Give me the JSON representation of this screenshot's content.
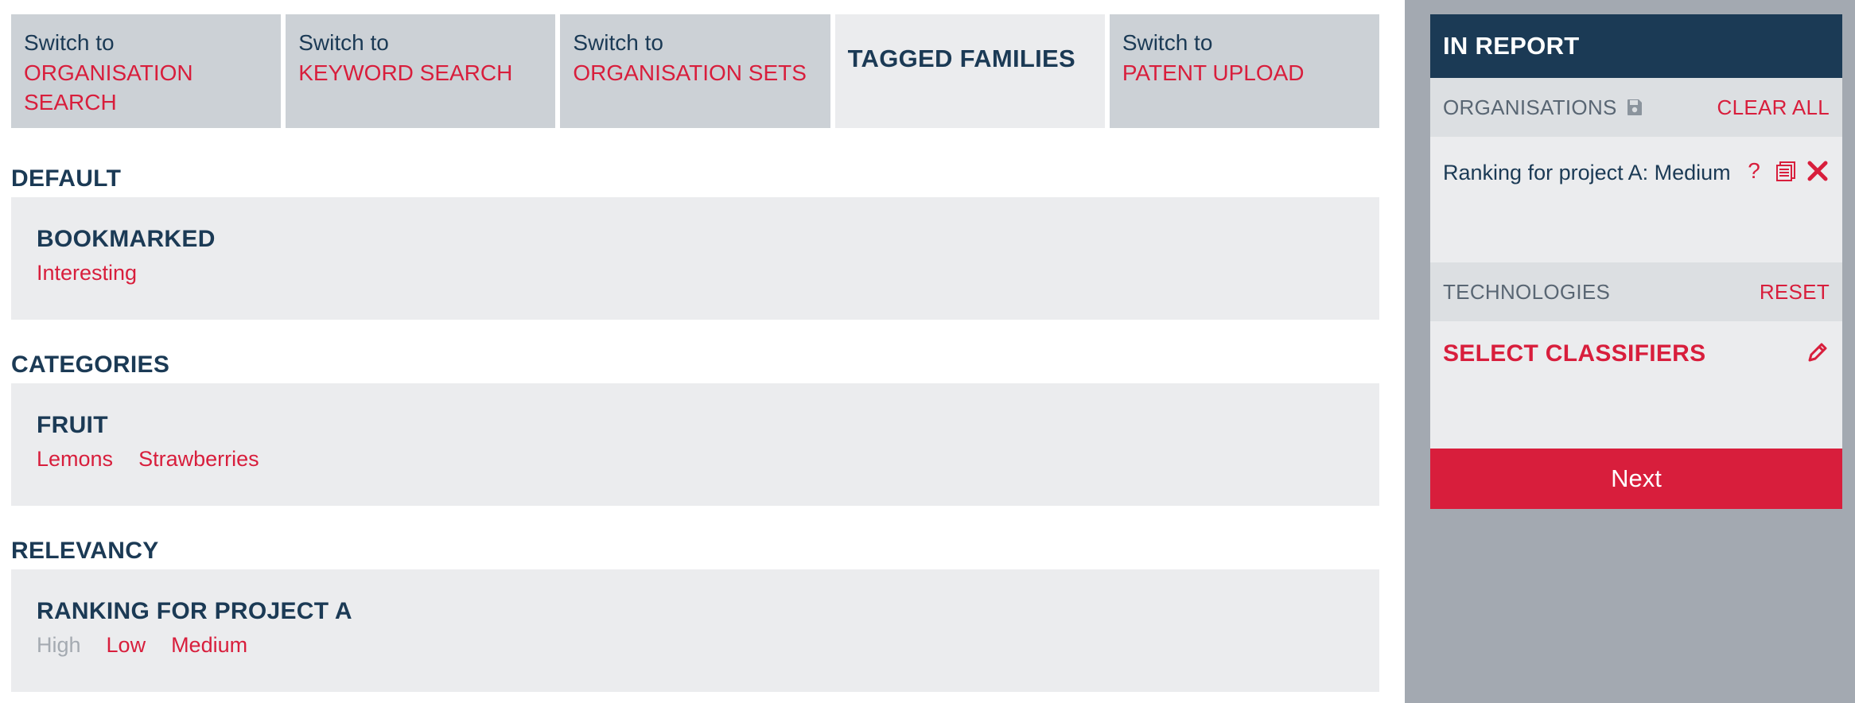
{
  "tabs": [
    {
      "line1": "Switch to",
      "line2": "ORGANISATION SEARCH"
    },
    {
      "line1": "Switch to",
      "line2": "KEYWORD SEARCH"
    },
    {
      "line1": "Switch to",
      "line2": "ORGANISATION SETS"
    },
    {
      "title": "TAGGED FAMILIES"
    },
    {
      "line1": "Switch to",
      "line2": "PATENT UPLOAD"
    }
  ],
  "sections": {
    "default": {
      "title": "DEFAULT",
      "panel_heading": "BOOKMARKED",
      "tags": [
        "Interesting"
      ]
    },
    "categories": {
      "title": "CATEGORIES",
      "panel_heading": "FRUIT",
      "tags": [
        "Lemons",
        "Strawberries"
      ]
    },
    "relevancy": {
      "title": "RELEVANCY",
      "panel_heading": "RANKING FOR PROJECT A",
      "tags": [
        "High",
        "Low",
        "Medium"
      ]
    }
  },
  "report": {
    "header": "IN REPORT",
    "organisations_label": "ORGANISATIONS",
    "clear_all": "CLEAR ALL",
    "selected_org": "Ranking for project A: Medium",
    "help_glyph": "?",
    "technologies_label": "TECHNOLOGIES",
    "reset": "RESET",
    "select_classifiers": "SELECT CLASSIFIERS",
    "next": "Next"
  },
  "icons": {
    "save": "floppy-disk-icon",
    "help": "question-icon",
    "list": "list-icon",
    "remove": "close-icon",
    "edit": "pencil-icon"
  },
  "colors": {
    "navy": "#1b3a55",
    "accent_red": "#d81e3c",
    "tab_bg": "#ccd1d6",
    "panel_bg": "#ebecee",
    "sidebar_bg": "#a3a9b1",
    "disabled_text": "#a4aab1"
  }
}
